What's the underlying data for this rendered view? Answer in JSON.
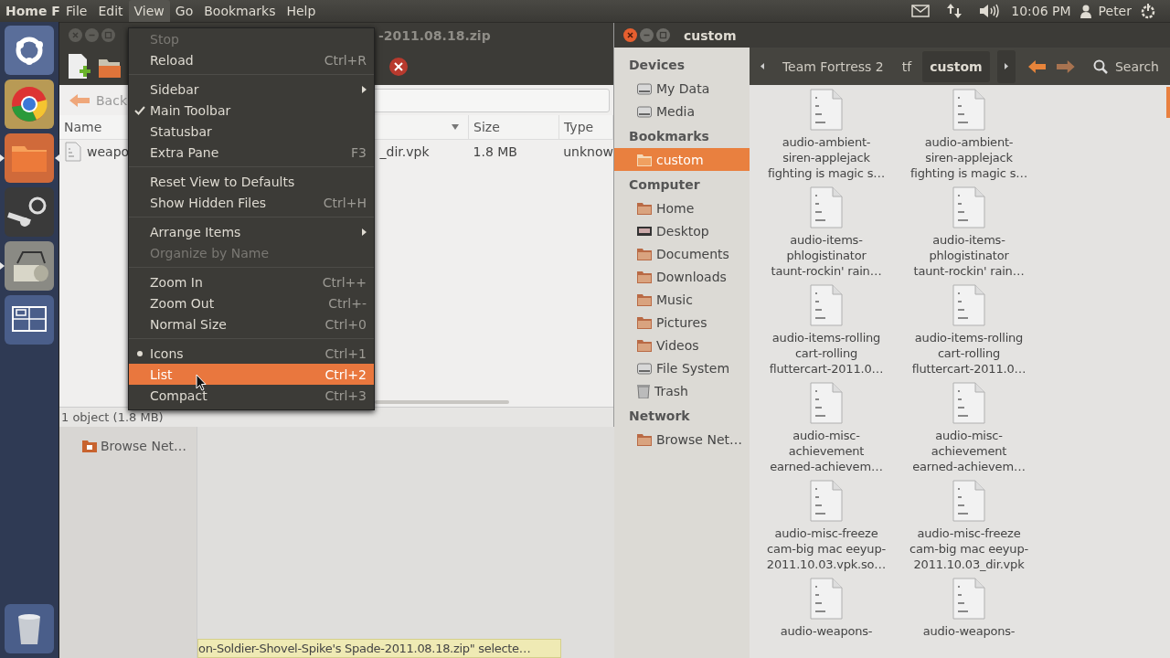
{
  "top_panel": {
    "app_title": "Home F",
    "menus": [
      {
        "label": "File",
        "selected": false
      },
      {
        "label": "Edit",
        "selected": false
      },
      {
        "label": "View",
        "selected": true
      },
      {
        "label": "Go",
        "selected": false
      },
      {
        "label": "Bookmarks",
        "selected": false
      },
      {
        "label": "Help",
        "selected": false
      }
    ],
    "clock": "10:06 PM",
    "user": "Peter"
  },
  "launcher": {
    "items": [
      {
        "kind": "dash",
        "running": false,
        "focused": false
      },
      {
        "kind": "browser",
        "running": false,
        "focused": false
      },
      {
        "kind": "files",
        "running": true,
        "focused": true
      },
      {
        "kind": "game",
        "running": false,
        "focused": false
      },
      {
        "kind": "archive",
        "running": true,
        "focused": false
      },
      {
        "kind": "workspaces",
        "running": false,
        "focused": false
      }
    ],
    "trash": {
      "kind": "trash"
    }
  },
  "archive_window": {
    "title": "-2011.08.18.zip",
    "back_button": "Back",
    "columns": [
      {
        "label": "Name",
        "sorted": true
      },
      {
        "label": "Size",
        "sorted": false
      },
      {
        "label": "Type",
        "sorted": false
      }
    ],
    "rows": [
      {
        "name_start": "weapo",
        "name_end": "_dir.vpk",
        "size": "1.8 MB",
        "type": "unknow"
      }
    ],
    "status": "1 object (1.8 MB)"
  },
  "back_window": {
    "sidebar_items": [
      {
        "label": "Browse Net…"
      }
    ],
    "status_tip": "on-Soldier-Shovel-Spike's Spade-2011.08.18.zip\" selecte…"
  },
  "view_menu": {
    "groups": [
      [
        {
          "label": "Stop",
          "kind": "action",
          "disabled": true,
          "highlighted": false
        },
        {
          "label": "Reload",
          "shortcut": "Ctrl+R",
          "kind": "action",
          "disabled": false,
          "highlighted": false
        }
      ],
      [
        {
          "label": "Sidebar",
          "kind": "submenu",
          "disabled": false,
          "highlighted": false
        },
        {
          "label": "Main Toolbar",
          "kind": "check",
          "checked": true,
          "disabled": false,
          "highlighted": false
        },
        {
          "label": "Statusbar",
          "kind": "check",
          "checked": false,
          "disabled": false,
          "highlighted": false
        },
        {
          "label": "Extra Pane",
          "shortcut": "F3",
          "kind": "check",
          "checked": false,
          "disabled": false,
          "highlighted": false
        }
      ],
      [
        {
          "label": "Reset View to Defaults",
          "kind": "action",
          "disabled": false,
          "highlighted": false
        },
        {
          "label": "Show Hidden Files",
          "shortcut": "Ctrl+H",
          "kind": "check",
          "checked": false,
          "disabled": false,
          "highlighted": false
        }
      ],
      [
        {
          "label": "Arrange Items",
          "kind": "submenu",
          "disabled": false,
          "highlighted": false
        },
        {
          "label": "Organize by Name",
          "kind": "action",
          "disabled": true,
          "highlighted": false
        }
      ],
      [
        {
          "label": "Zoom In",
          "shortcut": "Ctrl++",
          "kind": "action",
          "disabled": false,
          "highlighted": false
        },
        {
          "label": "Zoom Out",
          "shortcut": "Ctrl+-",
          "kind": "action",
          "disabled": false,
          "highlighted": false
        },
        {
          "label": "Normal Size",
          "shortcut": "Ctrl+0",
          "kind": "action",
          "disabled": false,
          "highlighted": false
        }
      ],
      [
        {
          "label": "Icons",
          "shortcut": "Ctrl+1",
          "kind": "radio",
          "selected": true,
          "disabled": false,
          "highlighted": false
        },
        {
          "label": "List",
          "shortcut": "Ctrl+2",
          "kind": "radio",
          "selected": false,
          "disabled": false,
          "highlighted": true
        },
        {
          "label": "Compact",
          "shortcut": "Ctrl+3",
          "kind": "radio",
          "selected": false,
          "disabled": false,
          "highlighted": false
        }
      ]
    ]
  },
  "files_window": {
    "title": "custom",
    "sidebar": [
      {
        "heading": "Devices",
        "items": [
          {
            "label": "My Data",
            "kind": "drive",
            "selected": false
          },
          {
            "label": "Media",
            "kind": "drive",
            "selected": false
          }
        ]
      },
      {
        "heading": "Bookmarks",
        "items": [
          {
            "label": "custom",
            "kind": "folder",
            "selected": true
          }
        ]
      },
      {
        "heading": "Computer",
        "items": [
          {
            "label": "Home",
            "kind": "folder",
            "selected": false
          },
          {
            "label": "Desktop",
            "kind": "desktop",
            "selected": false
          },
          {
            "label": "Documents",
            "kind": "folder",
            "selected": false
          },
          {
            "label": "Downloads",
            "kind": "folder",
            "selected": false
          },
          {
            "label": "Music",
            "kind": "folder",
            "selected": false
          },
          {
            "label": "Pictures",
            "kind": "folder",
            "selected": false
          },
          {
            "label": "Videos",
            "kind": "folder",
            "selected": false
          },
          {
            "label": "File System",
            "kind": "drive",
            "selected": false
          },
          {
            "label": "Trash",
            "kind": "trash",
            "selected": false
          }
        ]
      },
      {
        "heading": "Network",
        "items": [
          {
            "label": "Browse Net…",
            "kind": "folder",
            "selected": false
          }
        ]
      }
    ],
    "path": [
      {
        "label": "Team Fortress 2",
        "selected": false
      },
      {
        "label": "tf",
        "selected": false
      },
      {
        "label": "custom",
        "selected": true
      }
    ],
    "search": "Search",
    "files": [
      {
        "lines": [
          "audio-ambient-",
          "siren-applejack",
          "fighting is magic s…"
        ]
      },
      {
        "lines": [
          "audio-ambient-",
          "siren-applejack",
          "fighting is magic s…"
        ]
      },
      {
        "lines": [
          "audio-items-",
          "phlogistinator",
          "taunt-rockin' rain…"
        ]
      },
      {
        "lines": [
          "audio-items-",
          "phlogistinator",
          "taunt-rockin' rain…"
        ]
      },
      {
        "lines": [
          "audio-items-rolling",
          "cart-rolling",
          "fluttercart-2011.0…"
        ]
      },
      {
        "lines": [
          "audio-items-rolling",
          "cart-rolling",
          "fluttercart-2011.0…"
        ]
      },
      {
        "lines": [
          "audio-misc-",
          "achievement",
          "earned-achievem…"
        ]
      },
      {
        "lines": [
          "audio-misc-",
          "achievement",
          "earned-achievem…"
        ]
      },
      {
        "lines": [
          "audio-misc-freeze",
          "cam-big mac eeyup-",
          "2011.10.03.vpk.so…"
        ]
      },
      {
        "lines": [
          "audio-misc-freeze",
          "cam-big mac eeyup-",
          "2011.10.03_dir.vpk"
        ]
      },
      {
        "lines": [
          "audio-weapons-"
        ]
      },
      {
        "lines": [
          "audio-weapons-"
        ]
      }
    ]
  }
}
